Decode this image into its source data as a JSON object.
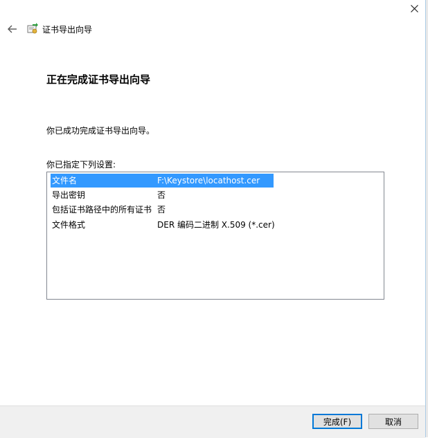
{
  "window": {
    "title": "证书导出向导",
    "close_glyph": "×"
  },
  "page": {
    "heading": "正在完成证书导出向导",
    "success_message": "你已成功完成证书导出向导。",
    "settings_label": "你已指定下列设置:"
  },
  "settings": [
    {
      "name": "文件名",
      "value": "F:\\Keystore\\locathost.cer"
    },
    {
      "name": "导出密钥",
      "value": "否"
    },
    {
      "name": "包括证书路径中的所有证书",
      "value": "否"
    },
    {
      "name": "文件格式",
      "value": "DER 编码二进制 X.509 (*.cer)"
    }
  ],
  "buttons": {
    "finish": "完成(F)",
    "cancel": "取消"
  },
  "icons": {
    "back": "back-arrow-icon",
    "wizard": "certificate-icon",
    "close": "close-icon"
  },
  "colors": {
    "selection": "#3399ff",
    "primary_border": "#0078d7"
  }
}
